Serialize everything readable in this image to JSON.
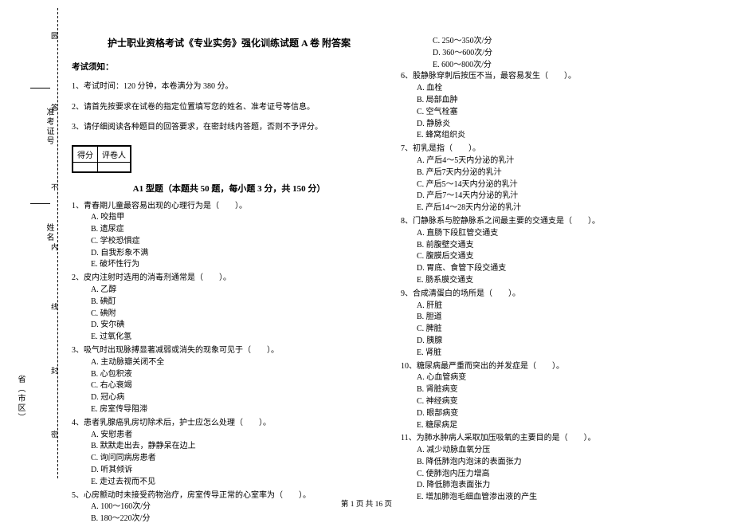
{
  "sidebar": {
    "marks": [
      "圆",
      "答",
      "不",
      "内",
      "线",
      "封",
      "密"
    ],
    "labels": [
      "准考证号",
      "姓名",
      "省（市区）"
    ]
  },
  "title": "护士职业资格考试《专业实务》强化训练试题 A 卷 附答案",
  "notice_head": "考试须知：",
  "notices": [
    "1、考试时间：120 分钟，本卷满分为 380 分。",
    "2、请首先按要求在试卷的指定位置填写您的姓名、准考证号等信息。",
    "3、请仔细阅读各种题目的回答要求，在密封线内答题，否则不予评分。"
  ],
  "score_labels": {
    "a": "得分",
    "b": "评卷人"
  },
  "section_title": "A1 型题（本题共 50 题，每小题 3 分，共 150 分）",
  "left_questions": [
    {
      "q": "1、青春期儿童最容易出现的心理行为是（　　）。",
      "opts": [
        "A. 咬指甲",
        "B. 遗尿症",
        "C. 学校恐惧症",
        "D. 自我形象不满",
        "E. 破坏性行为"
      ]
    },
    {
      "q": "2、皮内注射时选用的消毒剂通常是（　　）。",
      "opts": [
        "A. 乙醇",
        "B. 碘酊",
        "C. 碘附",
        "D. 安尔碘",
        "E. 过氧化氢"
      ]
    },
    {
      "q": "3、吸气时出现脉搏显著减弱或消失的现象可见于（　　）。",
      "opts": [
        "A. 主动脉瓣关闭不全",
        "B. 心包积液",
        "C. 右心衰竭",
        "D. 冠心病",
        "E. 房室传导阻滞"
      ]
    },
    {
      "q": "4、患者乳腺癌乳房切除术后，护士应怎么处理（　　）。",
      "opts": [
        "A. 安慰患者",
        "B. 默默走出去，静静呆在边上",
        "C. 询问同病房患者",
        "D. 听其倾诉",
        "E. 走过去视而不见"
      ]
    },
    {
      "q": "5、心房颤动时未接受药物治疗，房室传导正常的心室率为（　　）。",
      "opts": [
        "A. 100～160次/分",
        "B. 180～220次/分"
      ]
    }
  ],
  "right_top_opts": [
    "C. 250～350次/分",
    "D. 360～600次/分",
    "E. 600～800次/分"
  ],
  "right_questions": [
    {
      "q": "6、股静脉穿刺后按压不当，最容易发生（　　）。",
      "opts": [
        "A. 血栓",
        "B. 局部血肿",
        "C. 空气栓塞",
        "D. 静脉炎",
        "E. 蜂窝组织炎"
      ]
    },
    {
      "q": "7、初乳是指（　　）。",
      "opts": [
        "A. 产后4～5天内分泌的乳汁",
        "B. 产后7天内分泌的乳汁",
        "C. 产后5～14天内分泌的乳汁",
        "D. 产后7～14天内分泌的乳汁",
        "E. 产后14～28天内分泌的乳汁"
      ]
    },
    {
      "q": "8、门静脉系与腔静脉系之间最主要的交通支是（　　）。",
      "opts": [
        "A. 直肠下段肛管交通支",
        "B. 前腹壁交通支",
        "C. 腹膜后交通支",
        "D. 胃底、食管下段交通支",
        "E. 肠系膜交通支"
      ]
    },
    {
      "q": "9、合成清蛋白的场所是（　　）。",
      "opts": [
        "A. 肝脏",
        "B. 胆道",
        "C. 脾脏",
        "D. 胰腺",
        "E. 肾脏"
      ]
    },
    {
      "q": "10、糖尿病最严重而突出的并发症是（　　）。",
      "opts": [
        "A. 心血管病变",
        "B. 肾脏病变",
        "C. 神经病变",
        "D. 眼部病变",
        "E. 糖尿病足"
      ]
    },
    {
      "q": "11、为肺水肿病人采取加压吸氧的主要目的是（　　）。",
      "opts": [
        "A. 减少动脉血氧分压",
        "B. 降低肺泡内泡沫的表面张力",
        "C. 使肺泡内压力增高",
        "D. 降低肺泡表面张力",
        "E. 增加肺泡毛细血管渗出液的产生"
      ]
    }
  ],
  "footer": "第 1 页 共 16 页"
}
